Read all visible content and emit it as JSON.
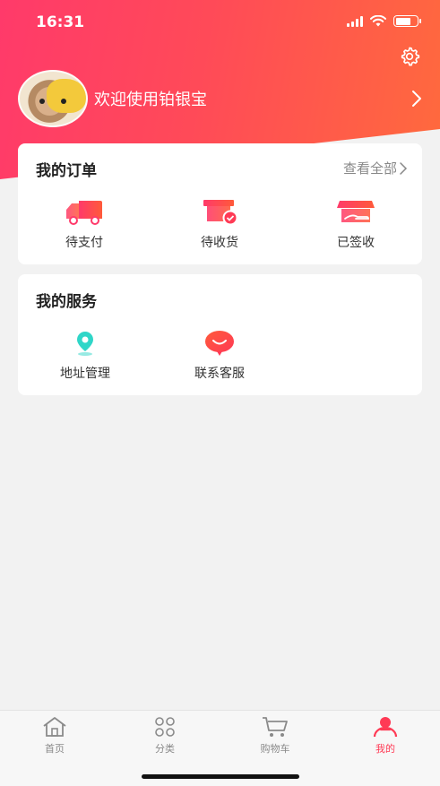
{
  "status_bar": {
    "time": "16:31"
  },
  "profile": {
    "greeting": "欢迎使用铂银宝"
  },
  "orders": {
    "title": "我的订单",
    "view_all": "查看全部",
    "items": [
      {
        "label": "待支付",
        "icon": "truck-icon"
      },
      {
        "label": "待收货",
        "icon": "package-check-icon"
      },
      {
        "label": "已签收",
        "icon": "store-hand-icon"
      }
    ]
  },
  "services": {
    "title": "我的服务",
    "items": [
      {
        "label": "地址管理",
        "icon": "location-pin-icon"
      },
      {
        "label": "联系客服",
        "icon": "chat-bubble-icon"
      }
    ]
  },
  "tabbar": {
    "items": [
      {
        "label": "首页",
        "icon": "home-icon",
        "active": false
      },
      {
        "label": "分类",
        "icon": "category-icon",
        "active": false
      },
      {
        "label": "购物车",
        "icon": "cart-icon",
        "active": false
      },
      {
        "label": "我的",
        "icon": "user-icon",
        "active": true
      }
    ]
  },
  "colors": {
    "accent": "#ff3a55",
    "gradient_start": "#ff3a6a",
    "gradient_end": "#ff6a3d",
    "location_icon": "#2fd6c8",
    "tab_inactive": "#8a8a8a"
  }
}
